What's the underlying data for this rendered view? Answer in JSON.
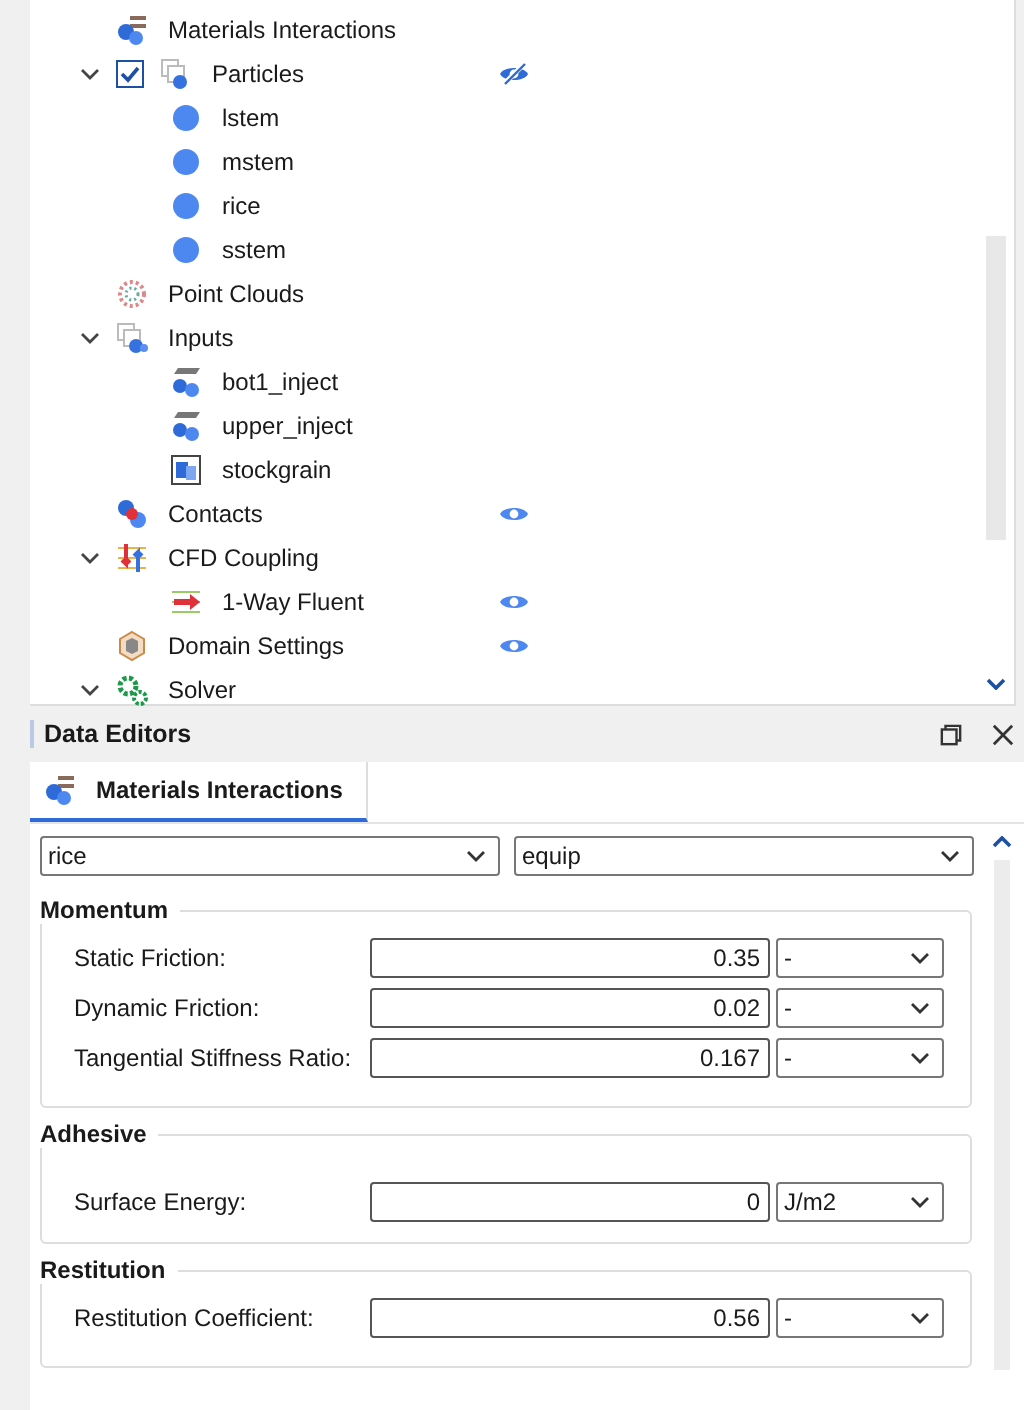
{
  "tree": {
    "items": [
      {
        "label": "Materials Interactions",
        "kind": "materials"
      },
      {
        "label": "Particles",
        "kind": "particles",
        "expanded": true,
        "checked": true,
        "visible": false,
        "children": [
          {
            "label": "lstem",
            "kind": "sphere"
          },
          {
            "label": "mstem",
            "kind": "sphere"
          },
          {
            "label": "rice",
            "kind": "sphere"
          },
          {
            "label": "sstem",
            "kind": "sphere"
          }
        ]
      },
      {
        "label": "Point Clouds",
        "kind": "pointcloud"
      },
      {
        "label": "Inputs",
        "kind": "inputs",
        "expanded": true,
        "children": [
          {
            "label": "bot1_inject",
            "kind": "injector"
          },
          {
            "label": "upper_inject",
            "kind": "injector"
          },
          {
            "label": "stockgrain",
            "kind": "stockgrain"
          }
        ]
      },
      {
        "label": "Contacts",
        "kind": "contacts",
        "visible": true
      },
      {
        "label": "CFD Coupling",
        "kind": "cfd",
        "expanded": true,
        "children": [
          {
            "label": "1-Way Fluent",
            "kind": "fluent",
            "visible": true
          }
        ]
      },
      {
        "label": "Domain Settings",
        "kind": "domain",
        "visible": true
      },
      {
        "label": "Solver",
        "kind": "solver",
        "expanded": true
      }
    ]
  },
  "data_editors": {
    "title": "Data Editors",
    "tabs": [
      {
        "label": "Materials Interactions",
        "selected": true
      }
    ],
    "material_a": "rice",
    "material_b": "equip",
    "groups": [
      {
        "title": "Momentum",
        "rows": [
          {
            "label": "Static Friction:",
            "value": "0.35",
            "unit": "-"
          },
          {
            "label": "Dynamic Friction:",
            "value": "0.02",
            "unit": "-"
          },
          {
            "label": "Tangential Stiffness Ratio:",
            "value": "0.167",
            "unit": "-"
          }
        ]
      },
      {
        "title": "Adhesive",
        "rows": [
          {
            "label": "Surface Energy:",
            "value": "0",
            "unit": "J/m2"
          }
        ]
      },
      {
        "title": "Restitution",
        "rows": [
          {
            "label": "Restitution Coefficient:",
            "value": "0.56",
            "unit": "-"
          }
        ]
      }
    ]
  }
}
